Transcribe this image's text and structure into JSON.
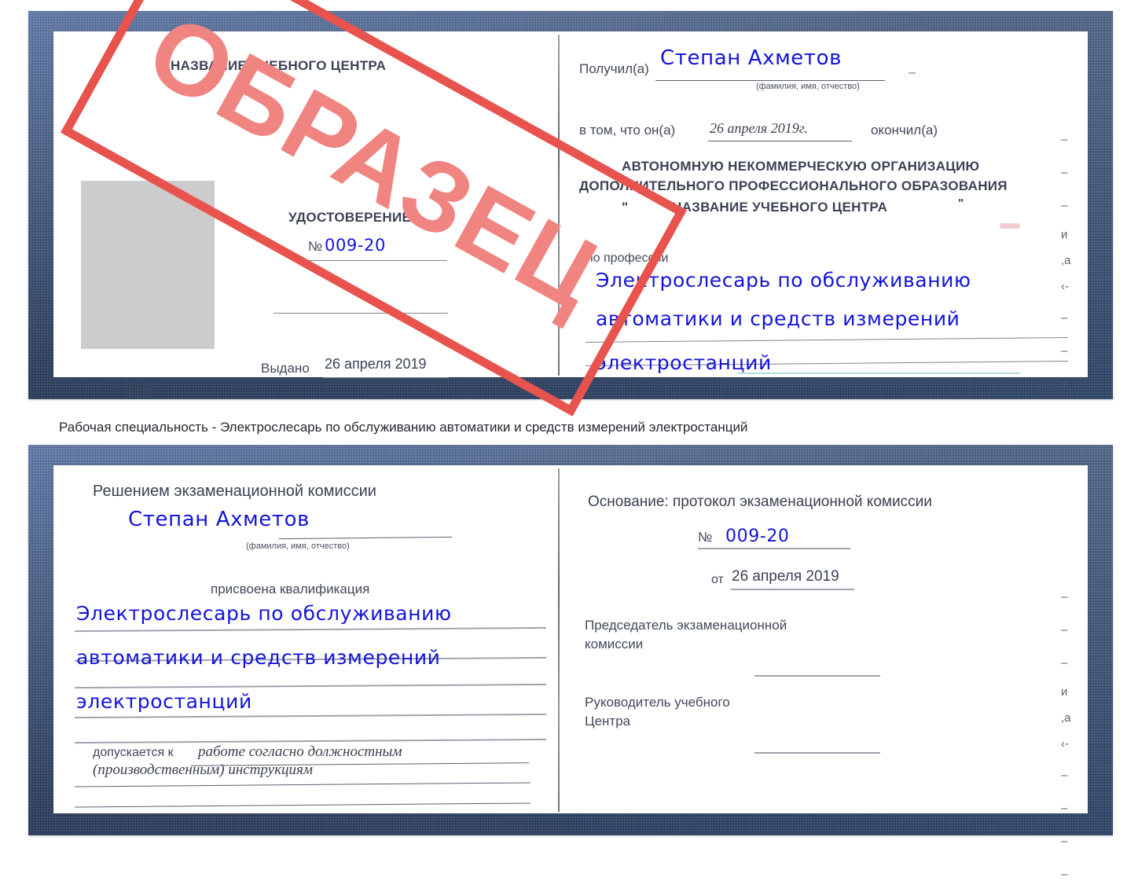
{
  "document": {
    "type": "certificate-sample-scan",
    "watermark_text": "ОБРАЗЕЦ",
    "watermark_color": "#e8534e"
  },
  "caption": {
    "text": "Рабочая специальность - Электрослесарь по обслуживанию автоматики и средств измерений электростанций"
  },
  "cert_top": {
    "left_page": {
      "org_title": "НАЗВАНИЕ УЧЕБНОГО ЦЕНТРА",
      "doc_title": "УДОСТОВЕРЕНИЕ",
      "number_label": "№",
      "number_value": "009-20",
      "issued_label": "Выдано",
      "issued_value": "26 апреля 2019",
      "seal_label": "М.П.",
      "photo_placeholder": "photo-box"
    },
    "right_page": {
      "received_label": "Получил(а)",
      "received_value": "Степан Ахметов",
      "name_hint": "(фамилия, имя, отчество)",
      "in_that_label": "в том, что он(а)",
      "date_value": "26 апреля 2019г.",
      "finished_label": "окончил(а)",
      "org_line_1": "АВТОНОМНУЮ НЕКОММЕРЧЕСКУЮ ОРГАНИЗАЦИЮ",
      "org_line_2": "ДОПОЛНИТЕЛЬНОГО ПРОФЕССИОНАЛЬНОГО ОБРАЗОВАНИЯ",
      "org_quote_open": "\"",
      "org_line_3": "НАЗВАНИЕ УЧЕБНОГО ЦЕНТРА",
      "org_quote_close": "\"",
      "profession_label": "по профессии",
      "profession_line_1": "Электрослесарь по обслуживанию",
      "profession_line_2": "автоматики и средств измерений",
      "profession_line_3": "электростанций"
    },
    "margin_fragments": [
      "–",
      "–",
      "–",
      "и",
      ",а",
      "‹-",
      "–",
      "–",
      "–"
    ]
  },
  "cert_bottom": {
    "left_page": {
      "heading": "Решением экзаменационной комиссии",
      "name_value": "Степан Ахметов",
      "name_hint": "(фамилия, имя, отчество)",
      "qualification_label": "присвоена квалификация",
      "qualification_line_1": "Электрослесарь по обслуживанию",
      "qualification_line_2": "автоматики и средств измерений",
      "qualification_line_3": "электростанций",
      "allowed_label": "допускается к",
      "allowed_value_1": "работе согласно должностным",
      "allowed_value_2": "(производственным) инструкциям"
    },
    "right_page": {
      "basis_label": "Основание: протокол экзаменационной комиссии",
      "number_label": "№",
      "number_value": "009-20",
      "date_label": "от",
      "date_value": "26 апреля 2019",
      "chairman_line_1": "Председатель экзаменационной",
      "chairman_line_2": "комиссии",
      "head_line_1": "Руководитель учебного",
      "head_line_2": "Центра"
    },
    "margin_fragments": [
      "–",
      "–",
      "–",
      "и",
      ",а",
      "‹-",
      "–",
      "–",
      "–",
      "–"
    ]
  }
}
